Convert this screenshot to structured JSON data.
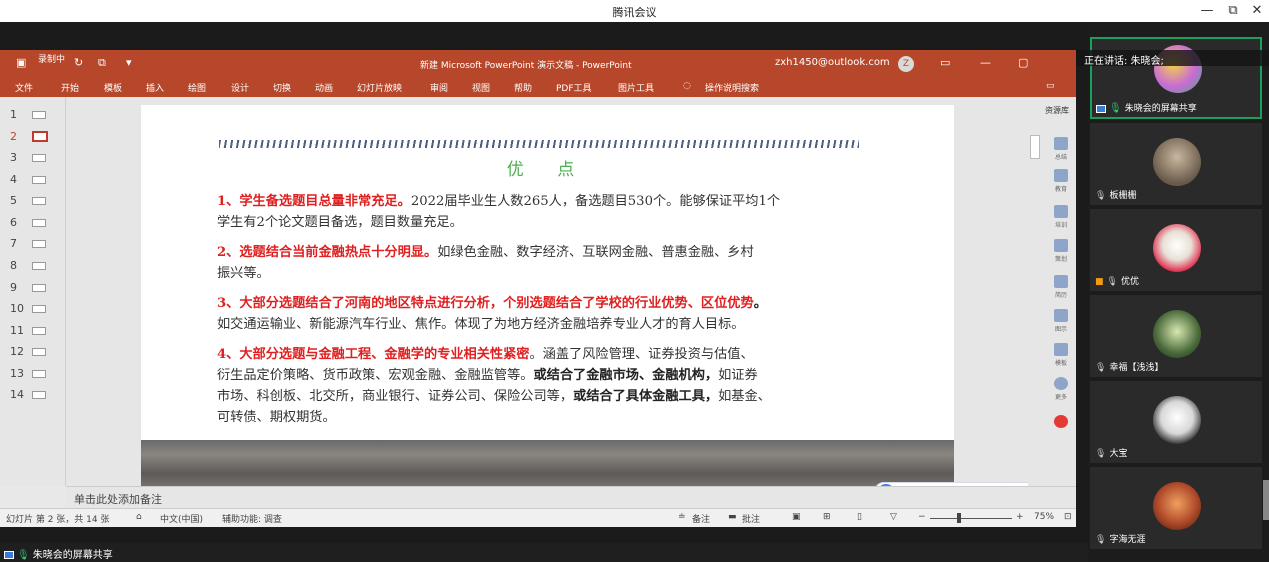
{
  "app": {
    "title": "腾讯会议",
    "window_controls": {
      "minimize": "—",
      "restore": "⧉",
      "close": "✕"
    }
  },
  "share_footer": {
    "label": "朱晓会的屏幕共享"
  },
  "ppt": {
    "title": "新建 Microsoft PowerPoint 演示文稿  -  PowerPoint",
    "user": "zxh1450@outlook.com",
    "avatar_initial": "Z",
    "quick_access": {
      "recording": "录制中"
    },
    "ribbon_tabs": [
      "文件",
      "开始",
      "模板",
      "插入",
      "绘图",
      "设计",
      "切换",
      "动画",
      "幻灯片放映",
      "审阅",
      "视图",
      "帮助",
      "PDF工具",
      "图片工具"
    ],
    "tell_me": "操作说明搜索",
    "slide_numbers": [
      "1",
      "2",
      "3",
      "4",
      "5",
      "6",
      "7",
      "8",
      "9",
      "10",
      "11",
      "12",
      "13",
      "14"
    ],
    "active_slide_index": 1,
    "notes_placeholder": "单击此处添加备注",
    "resource_pane": {
      "header": "资源库",
      "items": [
        "总结",
        "教育",
        "培训",
        "策划",
        "简历",
        "图示",
        "模板",
        "更多"
      ]
    },
    "status": {
      "slide_info": "幻灯片 第 2 张，共 14 张",
      "language": "中文(中国)",
      "accessibility": "辅助功能: 调查",
      "notes": "备注",
      "comments": "批注",
      "zoom": "75%",
      "zoom_fraction": 0.75
    }
  },
  "slide": {
    "title": "优  点",
    "p1": {
      "red": "1、学生备选题目总量非常充足。",
      "l1": "2022届毕业生人数265人，备选题目530个。能够保证平均1个",
      "l2": "学生有2个论文题目备选，题目数量充足。"
    },
    "p2": {
      "red": "2、选题结合当前金融热点十分明显。",
      "l1": "如绿色金融、数字经济、互联网金融、普惠金融、乡村",
      "l2": "振兴等。"
    },
    "p3": {
      "red": "3、大部分选题结合了河南的地区特点进行分析，个别选题结合了学校的行业优势、区位优势",
      "tail": "。",
      "l2": "如交通运输业、新能源汽车行业、焦作。体现了为地方经济金融培养专业人才的育人目标。"
    },
    "p4": {
      "red": "4、大部分选题与金融工程、金融学的专业相关性紧密",
      "l1": "。涵盖了风险管理、证券投资与估值、",
      "l2a": "衍生品定价策略、货币政策、宏观金融、金融监管等。",
      "l2b": "或结合了金融市场、金融机构，",
      "l2c": "如证券",
      "l3a": "市场、科创板、北交所，商业银行、证券公司、保险公司等，",
      "l3b": "或结合了具体金融工具，",
      "l3c": "如基金、",
      "l4": "可转债、期权期货。"
    }
  },
  "ime": {
    "logo": "S",
    "items": [
      "中",
      "°,",
      "✎",
      "✂",
      "▦",
      "👕",
      "⚙"
    ]
  },
  "speaker": {
    "text": "正在讲话: 朱晓会;"
  },
  "participants": [
    {
      "name": "朱晓会的屏幕共享",
      "active": true,
      "avatar_color": "#c86ad8"
    },
    {
      "name": "板栅栅",
      "active": false,
      "avatar_color": "#8a7a6a"
    },
    {
      "name": "优优",
      "active": false,
      "avatar_color": "#e8e0d6"
    },
    {
      "name": "幸福【浅浅】",
      "active": false,
      "avatar_color": "#4a6a3a"
    },
    {
      "name": "大宝",
      "active": false,
      "avatar_color": "#d8d8d8"
    },
    {
      "name": "字海无涯",
      "active": false,
      "avatar_color": "#b04a2a"
    }
  ]
}
